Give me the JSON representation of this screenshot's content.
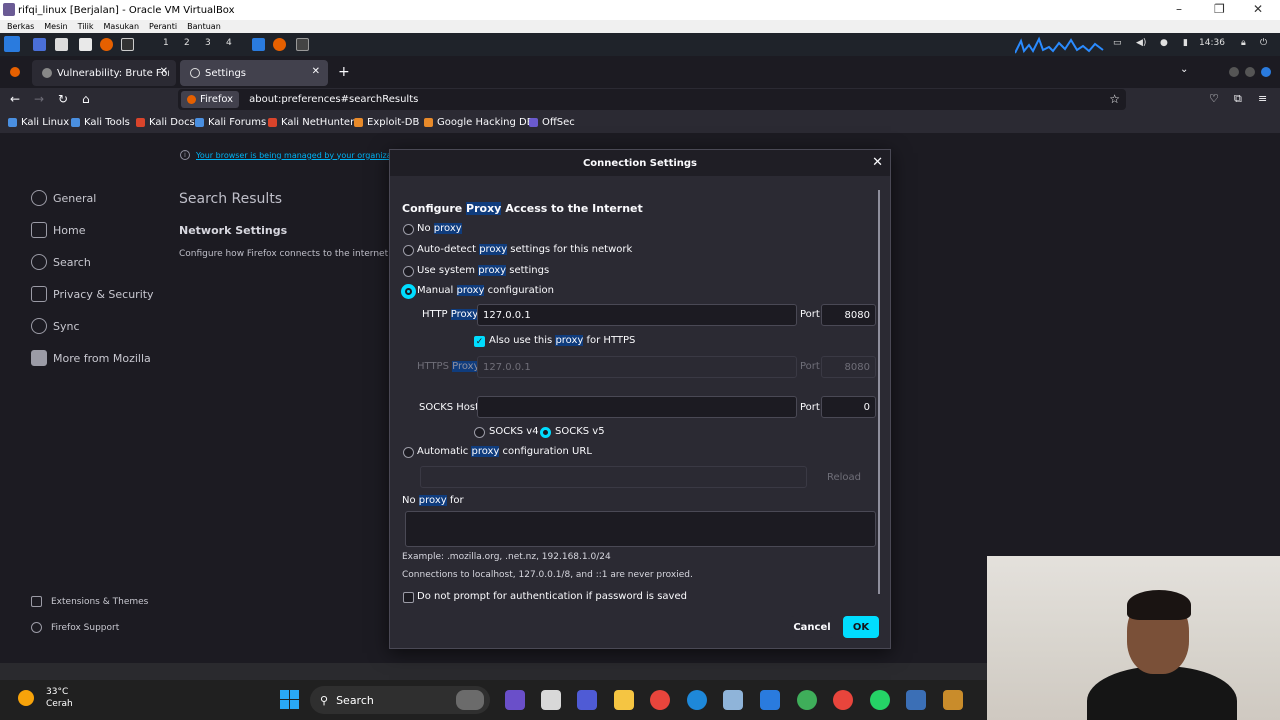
{
  "vbox": {
    "title": "rifqi_linux [Berjalan] - Oracle VM VirtualBox",
    "menu": [
      "Berkas",
      "Mesin",
      "Tilik",
      "Masukan",
      "Peranti",
      "Bantuan"
    ]
  },
  "kali_panel": {
    "workspaces": [
      "1",
      "2",
      "3",
      "4"
    ],
    "clock": "14:36"
  },
  "firefox": {
    "tabs": [
      {
        "label": "Vulnerability: Brute Force",
        "active": false
      },
      {
        "label": "Settings",
        "active": true
      }
    ],
    "url_identity": "Firefox",
    "url": "about:preferences#searchResults",
    "bookmarks": [
      "Kali Linux",
      "Kali Tools",
      "Kali Docs",
      "Kali Forums",
      "Kali NetHunter",
      "Exploit-DB",
      "Google Hacking DB",
      "OffSec"
    ]
  },
  "settings_page": {
    "managed_notice": "Your browser is being managed by your organizati",
    "sidebar": [
      "General",
      "Home",
      "Search",
      "Privacy & Security",
      "Sync",
      "More from Mozilla"
    ],
    "sidebar_footer": [
      "Extensions & Themes",
      "Firefox Support"
    ],
    "search_results_title": "Search Results",
    "network_title": "Network Settings",
    "network_desc": "Configure how Firefox connects to the internet."
  },
  "dialog": {
    "title": "Connection Settings",
    "heading_pre": "Configure ",
    "heading_hl": "Proxy",
    "heading_post": " Access to the Internet",
    "options": {
      "no_proxy": {
        "pre": "No ",
        "hl": "proxy",
        "post": ""
      },
      "auto_detect": {
        "pre": "Auto-detect ",
        "hl": "proxy",
        "post": " settings for this network"
      },
      "system": {
        "pre": "Use system ",
        "hl": "proxy",
        "post": " settings"
      },
      "manual": {
        "pre": "Manual ",
        "hl": "proxy",
        "post": " configuration"
      },
      "auto_url": {
        "pre": "Automatic ",
        "hl": "proxy",
        "post": " configuration URL"
      }
    },
    "selected_option": "manual",
    "http_proxy_label_pre": "HTTP ",
    "http_proxy_label_hl": "Proxy",
    "http_proxy": "127.0.0.1",
    "http_port": "8080",
    "port_label": "Port",
    "also_https": {
      "pre": "Also use this ",
      "hl": "proxy",
      "post": " for HTTPS",
      "checked": true
    },
    "https_proxy_label_pre": "HTTPS ",
    "https_proxy_label_hl": "Proxy",
    "https_proxy": "127.0.0.1",
    "https_port": "8080",
    "socks_label": "SOCKS Host",
    "socks_host": "",
    "socks_port": "0",
    "socks_v4": "SOCKS v4",
    "socks_v5": "SOCKS v5",
    "socks_version_selected": "v5",
    "reload_label": "Reload",
    "no_proxy_for_pre": "No ",
    "no_proxy_for_hl": "proxy",
    "no_proxy_for_post": " for",
    "example": "Example: .mozilla.org, .net.nz, 192.168.1.0/24",
    "localhost_note": "Connections to localhost, 127.0.0.1/8, and ::1 are never proxied.",
    "no_prompt_label": "Do not prompt for authentication if password is saved",
    "cancel_label": "Cancel",
    "ok_label": "OK"
  },
  "taskbar": {
    "temperature": "33°C",
    "weather": "Cerah",
    "search_label": "Search"
  },
  "colors": {
    "accent": "#00ddff",
    "highlight": "#0f3c7d",
    "page_bg": "#1c1b22",
    "dialog_bg": "#2b2a33"
  }
}
